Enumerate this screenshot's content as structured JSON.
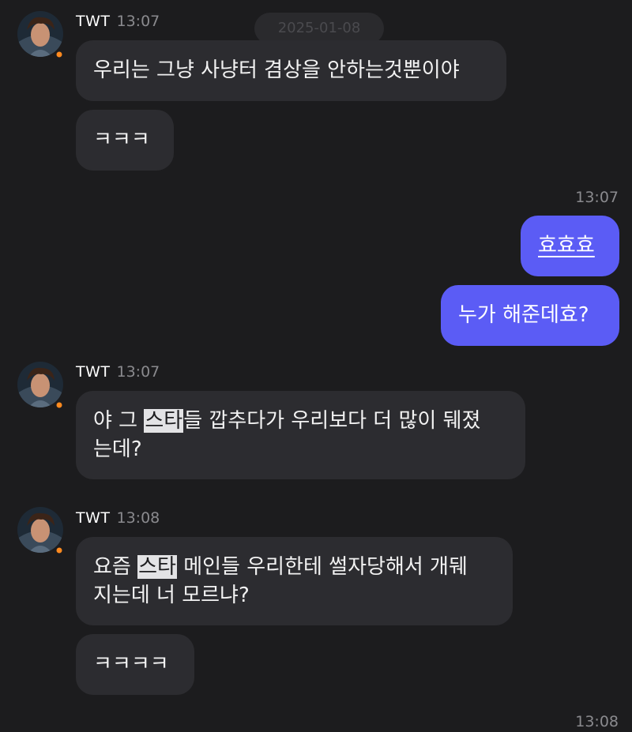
{
  "date_chip": "2025-01-08",
  "sender_name": "TWT",
  "groups": [
    {
      "sender_time": "13:07",
      "messages": [
        {
          "text": "우리는 그냥 사냥터 겸상을 안하는것뿐이야"
        },
        {
          "text": "ㅋㅋㅋ"
        }
      ]
    },
    {
      "sender_time": "13:07",
      "messages": [
        {
          "line1_pre": "야 그 ",
          "line1_hl": "스타",
          "line1_post": "들 깝추다가 우리보다 더 많이 뒈졌",
          "line2": "는데?"
        }
      ]
    },
    {
      "sender_time": "13:08",
      "messages": [
        {
          "line1_pre": "요즘 ",
          "line1_hl": "스타",
          "line1_post": " 메인들 우리한테 썰자당해서 개뒈",
          "line2": "지는데 너 모르냐?"
        },
        {
          "text": "ㅋㅋㅋㅋ"
        }
      ]
    }
  ],
  "outgoing": {
    "timestamp": "13:07",
    "messages": [
      {
        "text": "효효효"
      },
      {
        "text": "누가 해준데효?"
      }
    ]
  },
  "last_timestamp": "13:08",
  "colors": {
    "background": "#1c1c1e",
    "incoming_bubble": "#2c2c30",
    "outgoing_bubble": "#5b5cf5",
    "online_dot": "#ff8a1f"
  },
  "icons": {
    "avatar": "profile-avatar",
    "status": "online-status-dot"
  }
}
